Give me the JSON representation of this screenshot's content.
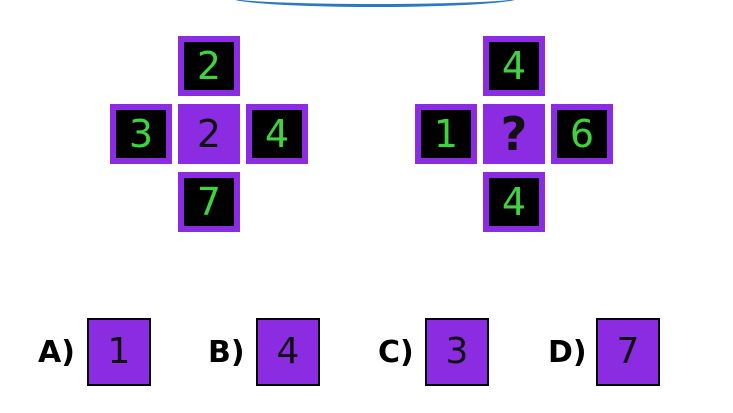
{
  "puzzle": {
    "left_cross": {
      "top": "2",
      "left": "3",
      "center": "2",
      "right": "4",
      "bottom": "7"
    },
    "right_cross": {
      "top": "4",
      "left": "1",
      "center": "?",
      "right": "6",
      "bottom": "4"
    }
  },
  "options": [
    {
      "letter": "A)",
      "value": "1"
    },
    {
      "letter": "B)",
      "value": "4"
    },
    {
      "letter": "C)",
      "value": "3"
    },
    {
      "letter": "D)",
      "value": "7"
    }
  ],
  "colors": {
    "purple": "#8b2be2",
    "green": "#3dd43d",
    "black": "#000000",
    "accent_arc": "#2b78c6"
  }
}
